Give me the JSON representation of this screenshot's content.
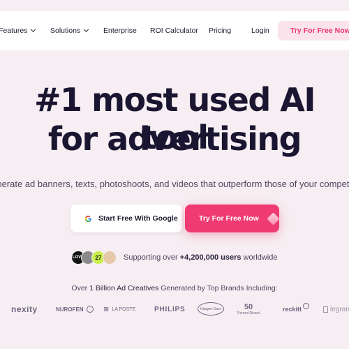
{
  "nav": {
    "items": [
      {
        "label": "Features",
        "dropdown": true
      },
      {
        "label": "Solutions",
        "dropdown": true
      },
      {
        "label": "Enterprise",
        "dropdown": false
      },
      {
        "label": "ROI Calculator",
        "dropdown": false
      },
      {
        "label": "Pricing",
        "dropdown": false
      }
    ],
    "login": "Login",
    "cta": "Try For Free Now"
  },
  "hero": {
    "headline_line1": "#1 most used AI tool",
    "headline_line2": "for advertising",
    "subtitle": "Generate ad banners, texts, photoshoots, and videos that outperform those of your competitors",
    "google_button": "Start Free With Google",
    "free_button": "Try For Free Now"
  },
  "social_proof": {
    "prefix": "Supporting over ",
    "count": "+4,200,000 users",
    "suffix": " worldwide",
    "avatar_labels": [
      "LOVE",
      "",
      "27",
      ""
    ]
  },
  "brands": {
    "prefix": "Over ",
    "highlight": "1 Billion Ad Creatives",
    "suffix": " Generated by Top Brands Including:",
    "logos": [
      "nexity",
      "NUROFEN",
      "LA POSTE",
      "PHILIPS",
      "Häagen-Dazs",
      "Pernod Ricard",
      "reckitt",
      "legrand"
    ],
    "pernod_number": "50"
  },
  "colors": {
    "background": "#f6eef2",
    "accent": "#ef3a72",
    "cta_light": "#fbe3ec",
    "heading": "#1a1530"
  }
}
